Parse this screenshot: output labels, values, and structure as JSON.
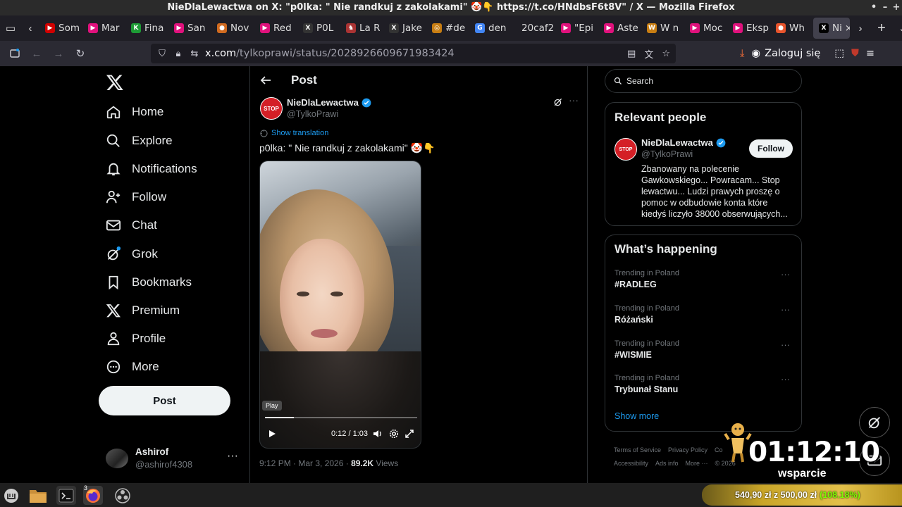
{
  "window": {
    "title": "NieDlaLewactwa on X: \"p0lka: \" Nie randkuj z zakolakami\" 🤡👇 https://t.co/HNdbsF6t8V\" / X — Mozilla Firefox",
    "controls": [
      "•",
      "–",
      "+",
      "×"
    ]
  },
  "tabs": [
    {
      "label": "Som",
      "color": "#d10000",
      "glyph": "▶"
    },
    {
      "label": "Mar",
      "color": "#e0117c",
      "glyph": "▶"
    },
    {
      "label": "Fina",
      "color": "#1d9b35",
      "glyph": "K"
    },
    {
      "label": "San",
      "color": "#e0117c",
      "glyph": "▶"
    },
    {
      "label": "Nov",
      "color": "#d06a1f",
      "glyph": "●"
    },
    {
      "label": "Red",
      "color": "#e0117c",
      "glyph": "▶"
    },
    {
      "label": "P0L",
      "color": "#333",
      "glyph": "X"
    },
    {
      "label": "La R",
      "color": "#a33",
      "glyph": "♞"
    },
    {
      "label": "Jake",
      "color": "#333",
      "glyph": "X"
    },
    {
      "label": "#de",
      "color": "#c77d12",
      "glyph": "◎"
    },
    {
      "label": "den",
      "color": "#4285f4",
      "glyph": "G"
    },
    {
      "label": "20caf2",
      "color": "transparent",
      "glyph": ""
    },
    {
      "label": "\"Epi",
      "color": "#e0117c",
      "glyph": "▶"
    },
    {
      "label": "Aste",
      "color": "#e0117c",
      "glyph": "▶"
    },
    {
      "label": "W n",
      "color": "#c77d12",
      "glyph": "W"
    },
    {
      "label": "Moc",
      "color": "#e0117c",
      "glyph": "▶"
    },
    {
      "label": "Eksp",
      "color": "#e0117c",
      "glyph": "▶"
    },
    {
      "label": "Wh",
      "color": "#e8542c",
      "glyph": "●"
    }
  ],
  "active_tab": {
    "label": "Ni",
    "glyph": "X"
  },
  "urlbar": {
    "domain": "x.com",
    "path": "/tylkoprawi/status/2028926609671983424"
  },
  "nav_right": {
    "login_label": "Zaloguj się"
  },
  "sidebar": {
    "items": [
      {
        "label": "Home",
        "icon": "home-icon"
      },
      {
        "label": "Explore",
        "icon": "search-icon"
      },
      {
        "label": "Notifications",
        "icon": "bell-icon"
      },
      {
        "label": "Follow",
        "icon": "follow-icon"
      },
      {
        "label": "Chat",
        "icon": "mail-icon"
      },
      {
        "label": "Grok",
        "icon": "grok-icon"
      },
      {
        "label": "Bookmarks",
        "icon": "bookmark-icon"
      },
      {
        "label": "Premium",
        "icon": "x-premium-icon"
      },
      {
        "label": "Profile",
        "icon": "profile-icon"
      },
      {
        "label": "More",
        "icon": "more-icon"
      }
    ],
    "post_button": "Post",
    "account": {
      "name": "Ashirof",
      "handle": "@ashirof4308",
      "more": "···"
    }
  },
  "post": {
    "header_title": "Post",
    "avatar_text": "STOP",
    "author_name": "NieDlaLewactwa",
    "author_handle": "@TylkoPrawi",
    "more": "···",
    "show_translation": "Show translation",
    "text": "p0lka: \" Nie randkuj z zakolakami\" 🤡👇",
    "video": {
      "tooltip": "Play",
      "time": "0:12 / 1:03",
      "progress": 0.19
    },
    "timestamp": "9:12 PM · Mar 3, 2026 · ",
    "views_count": "89.2K",
    "views_label": " Views"
  },
  "right": {
    "search_placeholder": "Search",
    "relevant": {
      "title": "Relevant people",
      "name": "NieDlaLewactwa",
      "handle": "@TylkoPrawi",
      "follow": "Follow",
      "bio": "Zbanowany na polecenie Gawkowskiego... Powracam... Stop lewactwu... Ludzi prawych proszę o pomoc w odbudowie konta które kiedyś liczyło 38000 obserwujących..."
    },
    "happening": {
      "title": "What’s happening",
      "trends": [
        {
          "context": "Trending in Poland",
          "name": "#RADLEG"
        },
        {
          "context": "Trending in Poland",
          "name": "Różański"
        },
        {
          "context": "Trending in Poland",
          "name": "#WISMIE"
        },
        {
          "context": "Trending in Poland",
          "name": "Trybunał Stanu"
        }
      ],
      "show_more": "Show more"
    },
    "footer": {
      "terms": "Terms of Service",
      "privacy": "Privacy Policy",
      "cookie": "Co",
      "accessibility": "Accessibility",
      "ads": "Ads info",
      "more": "More ···",
      "copy": "© 2026"
    }
  },
  "overlay": {
    "timer": "01:12:10",
    "label": "wsparcie",
    "donation": "540,90 zł z 500,00 zł",
    "donation_pct": "(108.18%)"
  },
  "taskbar": {
    "badge": "3"
  },
  "colors": {
    "accent": "#1d9bf0",
    "verified": "#1d9bf0",
    "stop_red": "#d41f26"
  }
}
